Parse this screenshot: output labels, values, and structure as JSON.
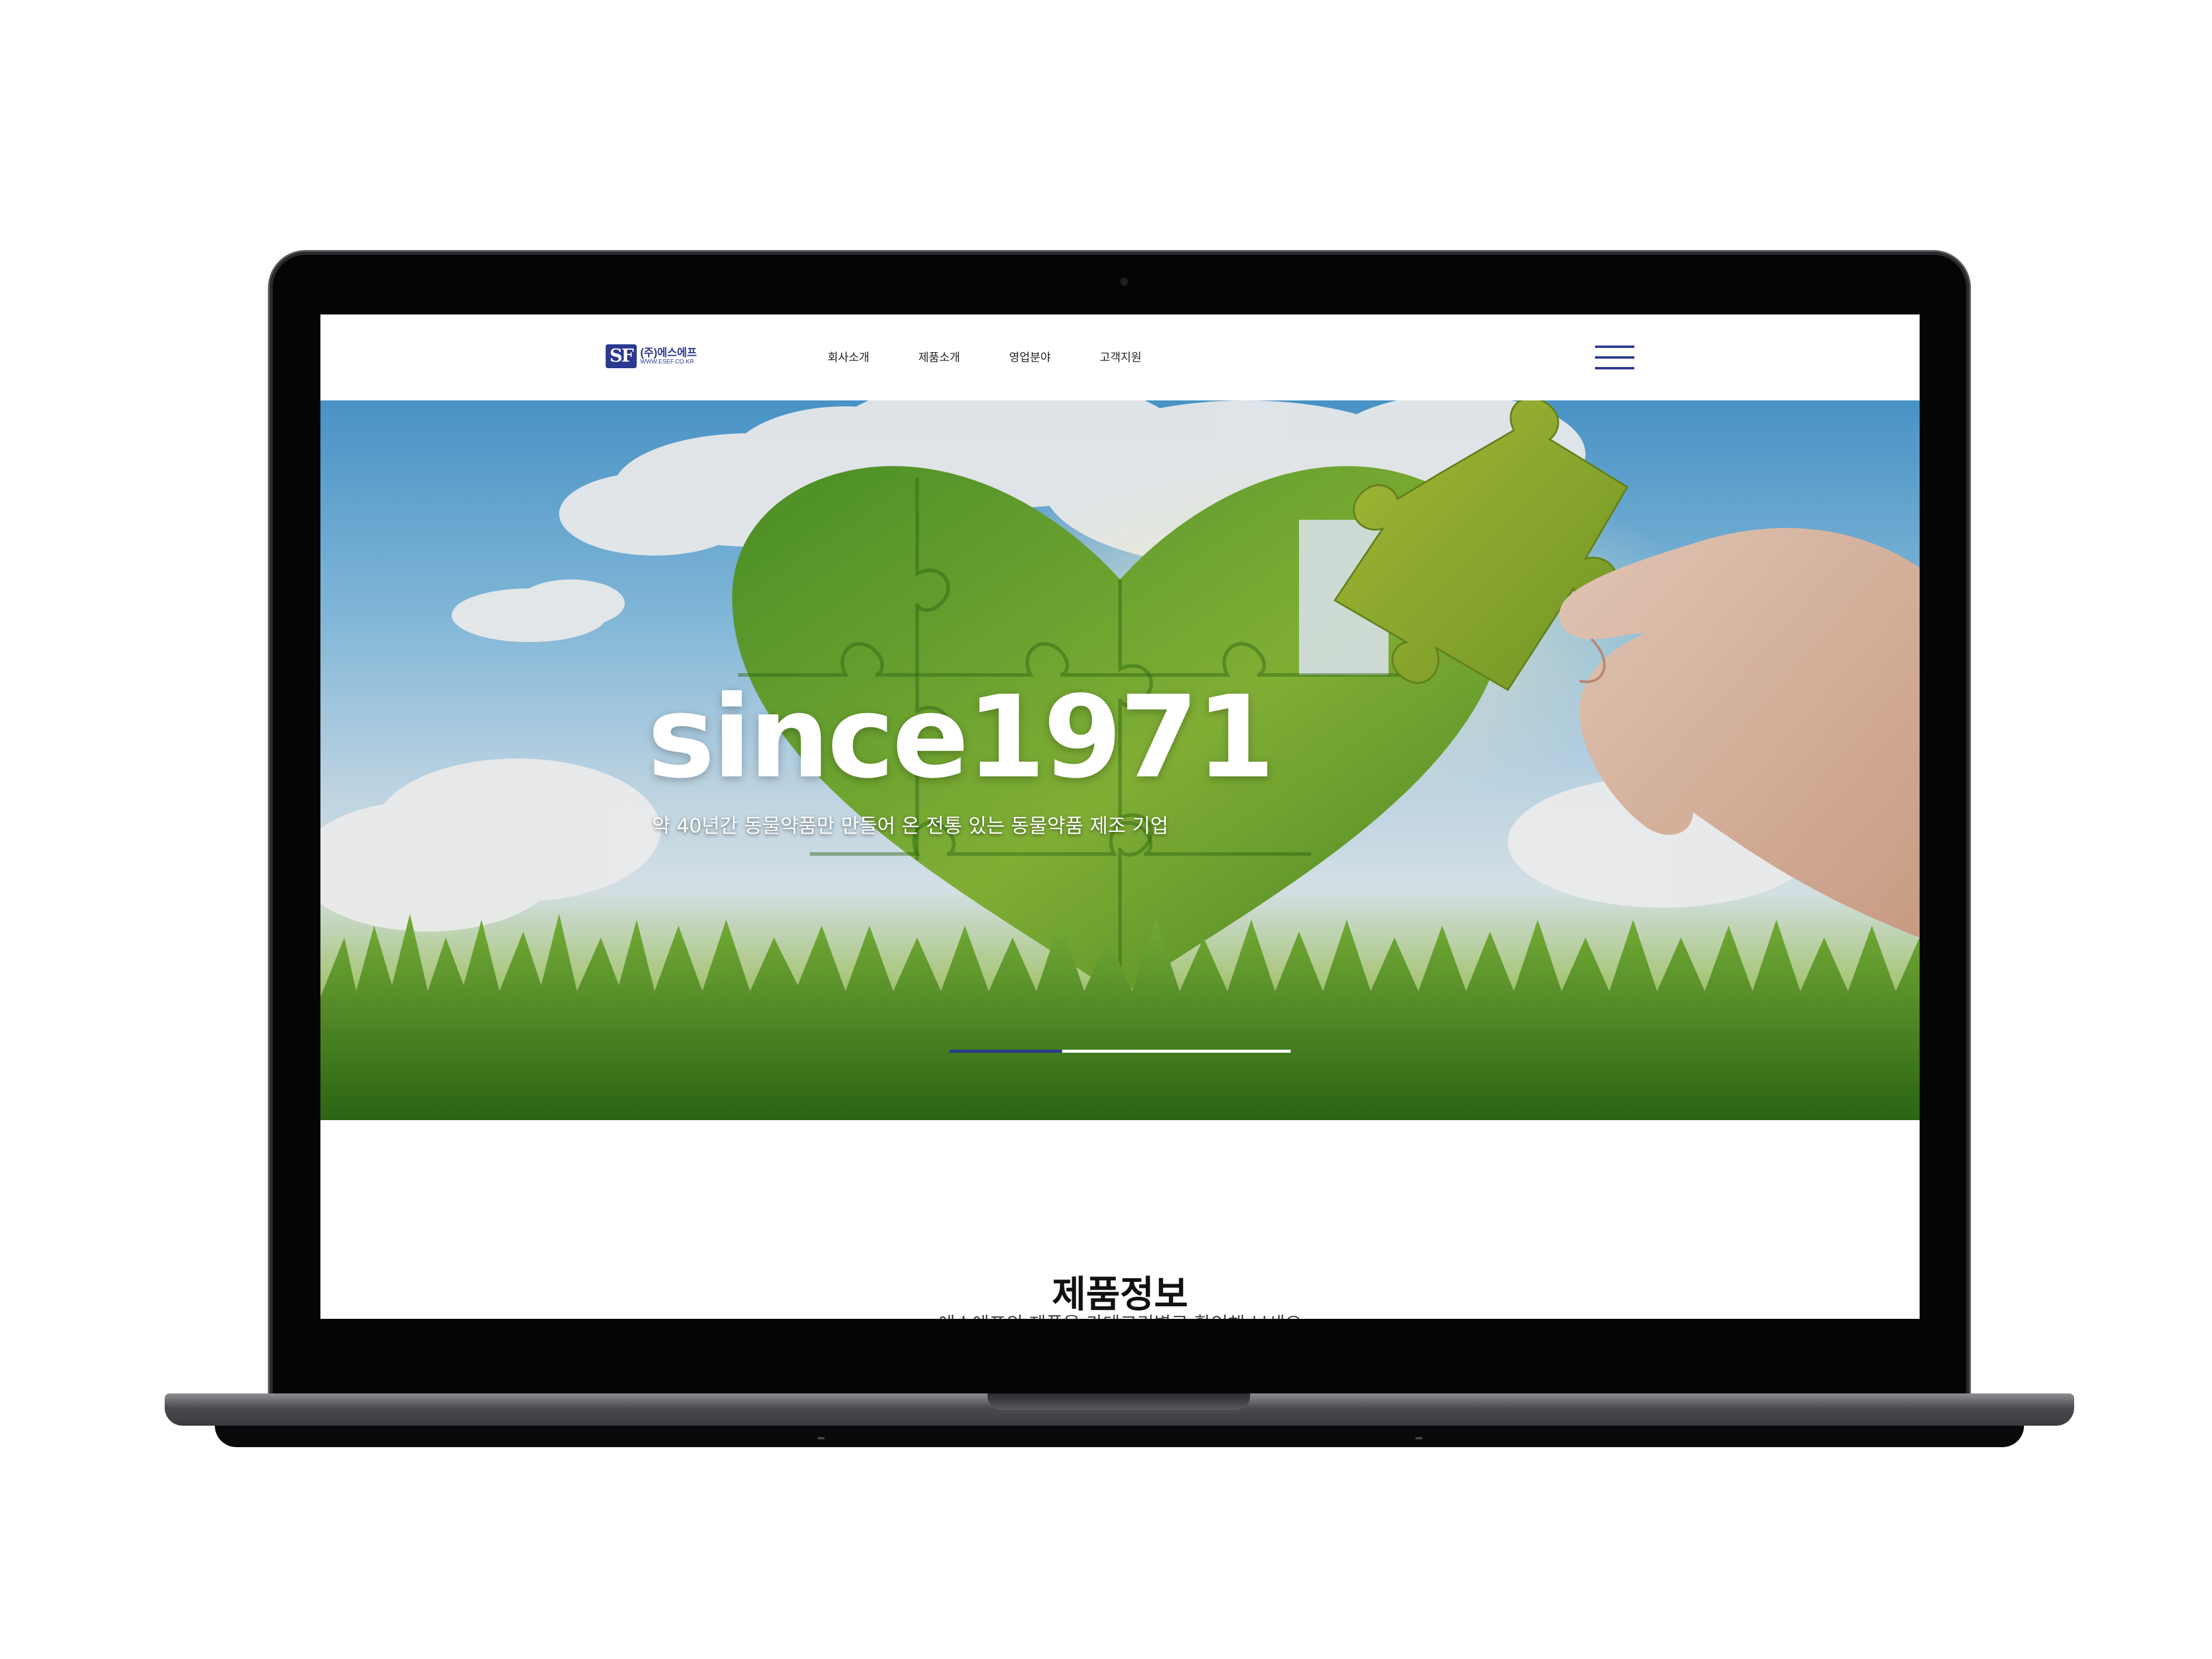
{
  "header": {
    "logo": {
      "mark": "SF",
      "name": "(주)에스에프",
      "url": "WWW.ESEF.CO.KR"
    },
    "nav": [
      {
        "label": "회사소개"
      },
      {
        "label": "제품소개"
      },
      {
        "label": "영업분야"
      },
      {
        "label": "고객지원"
      }
    ],
    "menu_icon": "hamburger-menu-icon"
  },
  "hero": {
    "title": "since1971",
    "subtitle": "약 40년간 동물약품만 만들어 온 전통 있는 동물약품 제조 기업",
    "slider": {
      "active_slide": 1,
      "total_slides": 3,
      "progress": 0.33
    }
  },
  "products": {
    "title": "제품정보",
    "subtitle": "에스에프의 제품을 카테고리별로 확인해 보세요"
  },
  "colors": {
    "brand": "#2b3990",
    "grass": "#5a9e2c",
    "sky": "#8cc6ea",
    "bezel": "#050505"
  }
}
